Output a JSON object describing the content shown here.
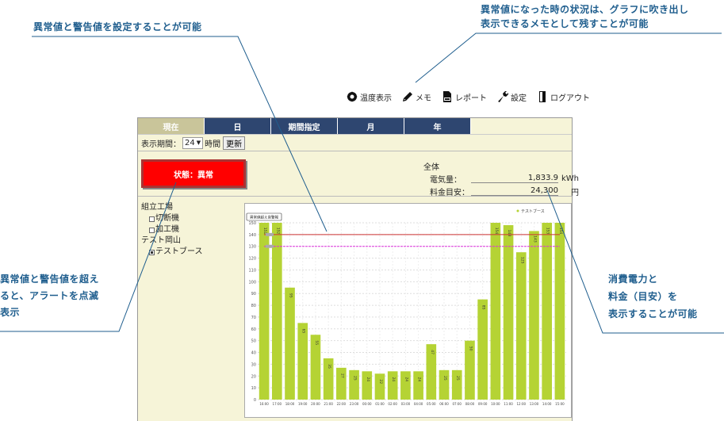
{
  "callouts": {
    "top_left": "異常値と警告値を設定することが可能",
    "top_right_1": "異常値になった時の状況は、グラフに吹き出し",
    "top_right_2": "表示できるメモとして残すことが可能",
    "left_1": "異常値と警告値を超え",
    "left_2": "ると、アラートを点滅",
    "left_3": "表示",
    "right_1": "消費電力と",
    "right_2": "料金（目安）を",
    "right_3": "表示することが可能"
  },
  "toolbar": {
    "temperature": "温度表示",
    "memo": "メモ",
    "report": "レポート",
    "settings": "設定",
    "logout": "ログアウト"
  },
  "tabs": [
    "現在",
    "日",
    "期間指定",
    "月",
    "年"
  ],
  "period": {
    "label": "表示期間：",
    "value": "24",
    "unit": "時間",
    "update": "更新"
  },
  "status": "状態：異常",
  "summary": {
    "title": "全体",
    "power_label": "電気量：",
    "power_value": "1,833.9",
    "power_unit": "kWh",
    "cost_label": "料金目安：",
    "cost_value": "24,300",
    "cost_unit": "円"
  },
  "tree": {
    "group1": "組立工場",
    "item1": "切断機",
    "item2": "加工機",
    "group2": "テスト岡山",
    "item3": "テストブース"
  },
  "colors": {
    "bar": "#b5d334",
    "abnormal_line": "#cc3333",
    "warning_line": "#dd33dd",
    "tab_dark": "#2e4670",
    "tab_active": "#c9c59a",
    "alert": "#ff0000",
    "callout": "#1f5e8e"
  },
  "chart_data": {
    "type": "bar",
    "categories": [
      "16:00",
      "17:00",
      "18:00",
      "19:00",
      "20:00",
      "21:00",
      "22:00",
      "23:00",
      "00:00",
      "01:00",
      "02:00",
      "03:00",
      "04:00",
      "05:00",
      "06:00",
      "07:00",
      "08:00",
      "09:00",
      "10:00",
      "11:00",
      "12:00",
      "13:00",
      "14:00",
      "15:00"
    ],
    "values": [
      151,
      152,
      95,
      65,
      55,
      35,
      27,
      25,
      24,
      22,
      24,
      24,
      24,
      47,
      25,
      25,
      50,
      85,
      154,
      148,
      125,
      143,
      153,
      154
    ],
    "ylim": [
      0,
      150
    ],
    "yticks": [
      0,
      10,
      20,
      30,
      40,
      50,
      60,
      70,
      80,
      90,
      100,
      110,
      120,
      130,
      140,
      150
    ],
    "abnormal_value": 140,
    "warning_value": 130,
    "legend": "テストブース",
    "memo_label": "異常値超え音警報",
    "grid": true
  }
}
